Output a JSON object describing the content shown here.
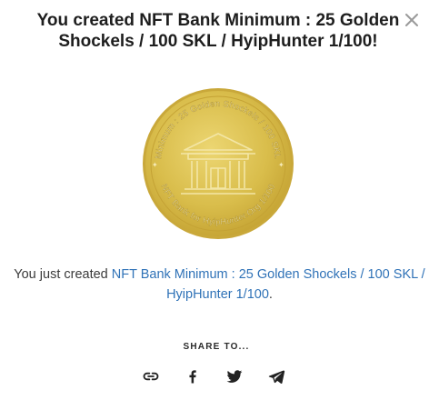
{
  "modal": {
    "title": "You created NFT Bank Minimum : 25 Golden Shockels / 100 SKL / HyipHunter 1/100!",
    "close_icon": "close-icon"
  },
  "coin": {
    "top_text": "Minimum : 25 Golden Shockels / 100 SKL",
    "bottom_text": "NFT Bank for HyipHunter.Org 1/100",
    "gold_color": "#d8bc4a",
    "icon": "bank-building-icon"
  },
  "message": {
    "prefix": "You just created ",
    "link_text": "NFT Bank Minimum : 25 Golden Shockels / 100 SKL / HyipHunter 1/100",
    "suffix": ".",
    "link_color": "#2f72b7"
  },
  "share": {
    "label": "SHARE TO...",
    "buttons": [
      {
        "name": "copy-link",
        "icon": "link-icon"
      },
      {
        "name": "facebook",
        "icon": "facebook-icon"
      },
      {
        "name": "twitter",
        "icon": "twitter-icon"
      },
      {
        "name": "telegram",
        "icon": "telegram-icon"
      }
    ]
  }
}
